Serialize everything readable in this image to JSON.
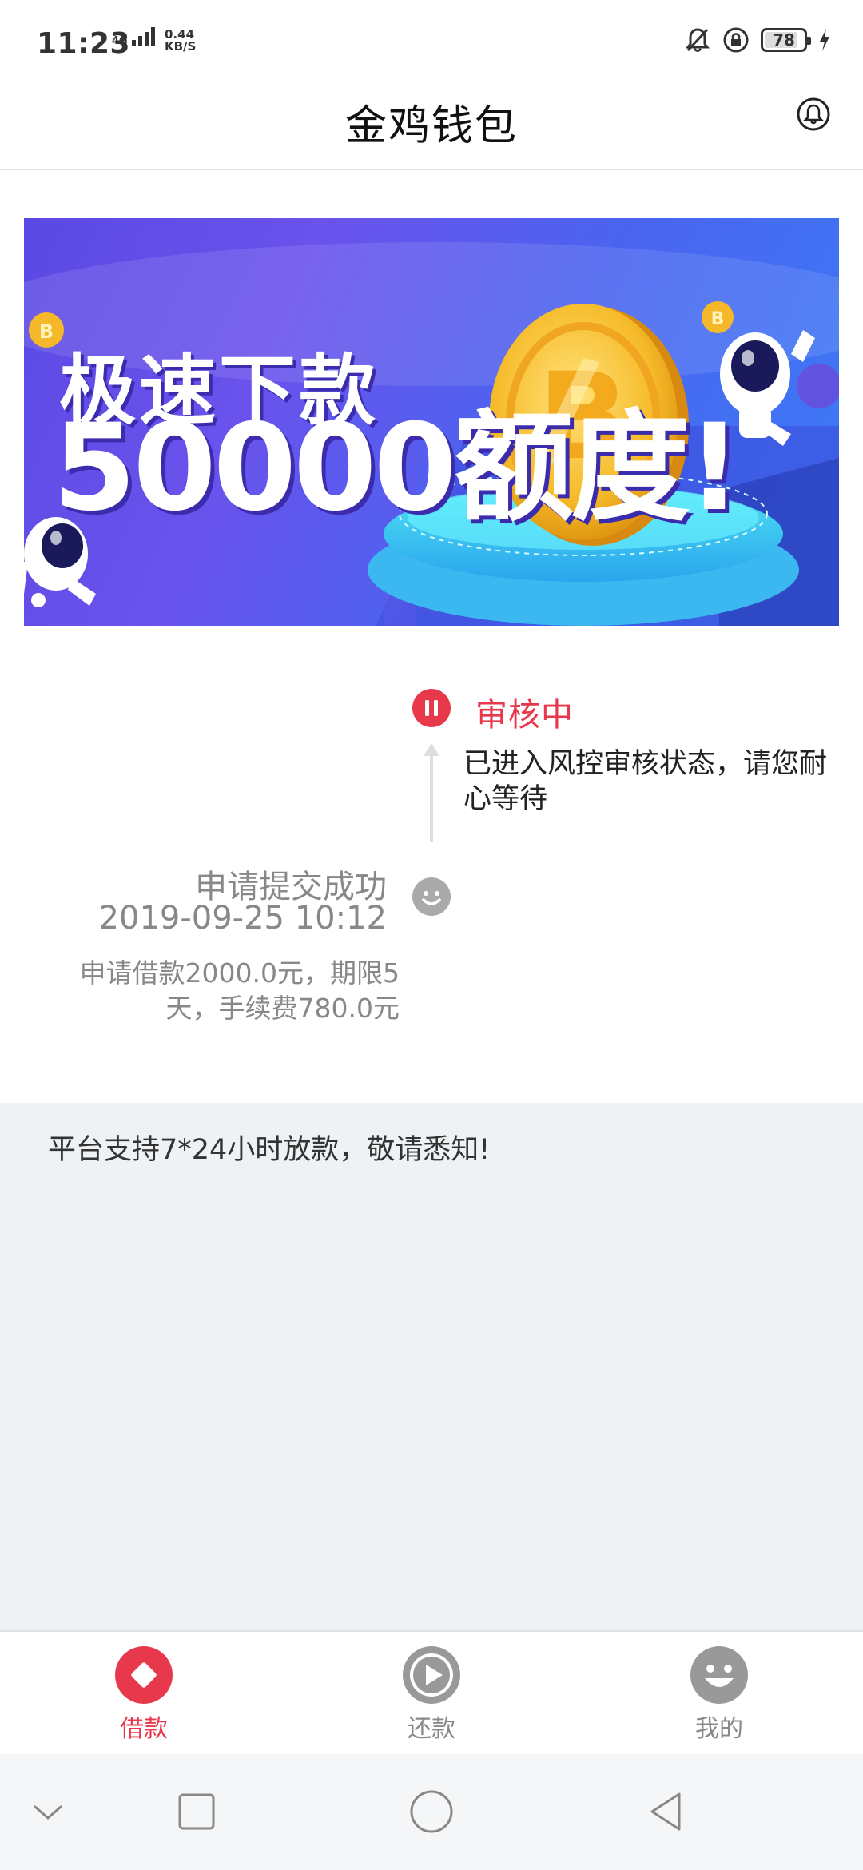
{
  "status_bar": {
    "time": "11:23",
    "network": "4G",
    "speed_value": "0.44",
    "speed_unit": "KB/S",
    "battery": "78"
  },
  "header": {
    "title": "金鸡钱包",
    "bell_icon": "bell-icon"
  },
  "banner": {
    "line1": "极速下款",
    "line2": "50000额度!"
  },
  "timeline": {
    "review": {
      "title": "审核中",
      "description": "已进入风控审核状态，请您耐心等待",
      "icon": "pause-icon",
      "color": "#e8384c"
    },
    "submitted": {
      "title": "申请提交成功",
      "time": "2019-09-25 10:12",
      "description": "申请借款2000.0元，期限5天，手续费780.0元",
      "icon": "smile-icon"
    }
  },
  "notice": {
    "text": "平台支持7*24小时放款，敬请悉知!"
  },
  "tabs": [
    {
      "label": "借款",
      "icon": "diamond-icon",
      "active": true
    },
    {
      "label": "还款",
      "icon": "play-icon",
      "active": false
    },
    {
      "label": "我的",
      "icon": "smile-icon",
      "active": false
    }
  ],
  "colors": {
    "accent": "#e8384c",
    "muted": "#888888",
    "notice_bg": "#eff2f5"
  }
}
